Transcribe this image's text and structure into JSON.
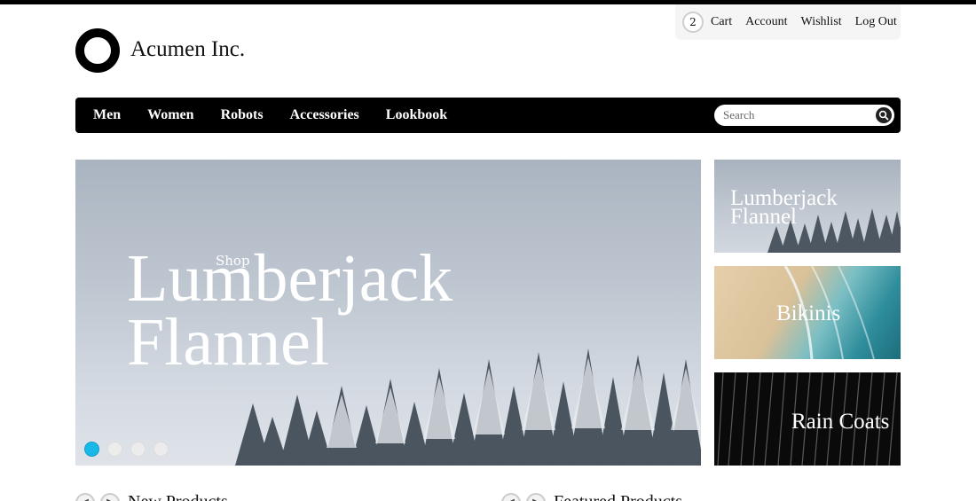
{
  "account": {
    "cart_count": "2",
    "links": [
      "Cart",
      "Account",
      "Wishlist",
      "Log Out"
    ]
  },
  "brand": {
    "name": "Acumen Inc.",
    "logo_icon": "ring-logo-icon"
  },
  "nav": {
    "items": [
      "Men",
      "Women",
      "Robots",
      "Accessories",
      "Lookbook"
    ],
    "search_placeholder": "Search",
    "search_icon": "search-icon"
  },
  "hero": {
    "kicker": "Shop",
    "title_line1": "Lumberjack",
    "title_line2": "Flannel",
    "slide_count": 4,
    "active_slide": 1
  },
  "tiles": [
    {
      "line1": "Lumberjack",
      "line2": "Flannel"
    },
    {
      "label": "Bikinis"
    },
    {
      "label": "Rain Coats"
    }
  ],
  "sections": {
    "new_products": "New Products",
    "featured_products": "Featured Products"
  },
  "colors": {
    "nav_bg": "#000000",
    "active_dot": "#1ab8e8",
    "account_bar_bg": "#f5f5f5"
  }
}
